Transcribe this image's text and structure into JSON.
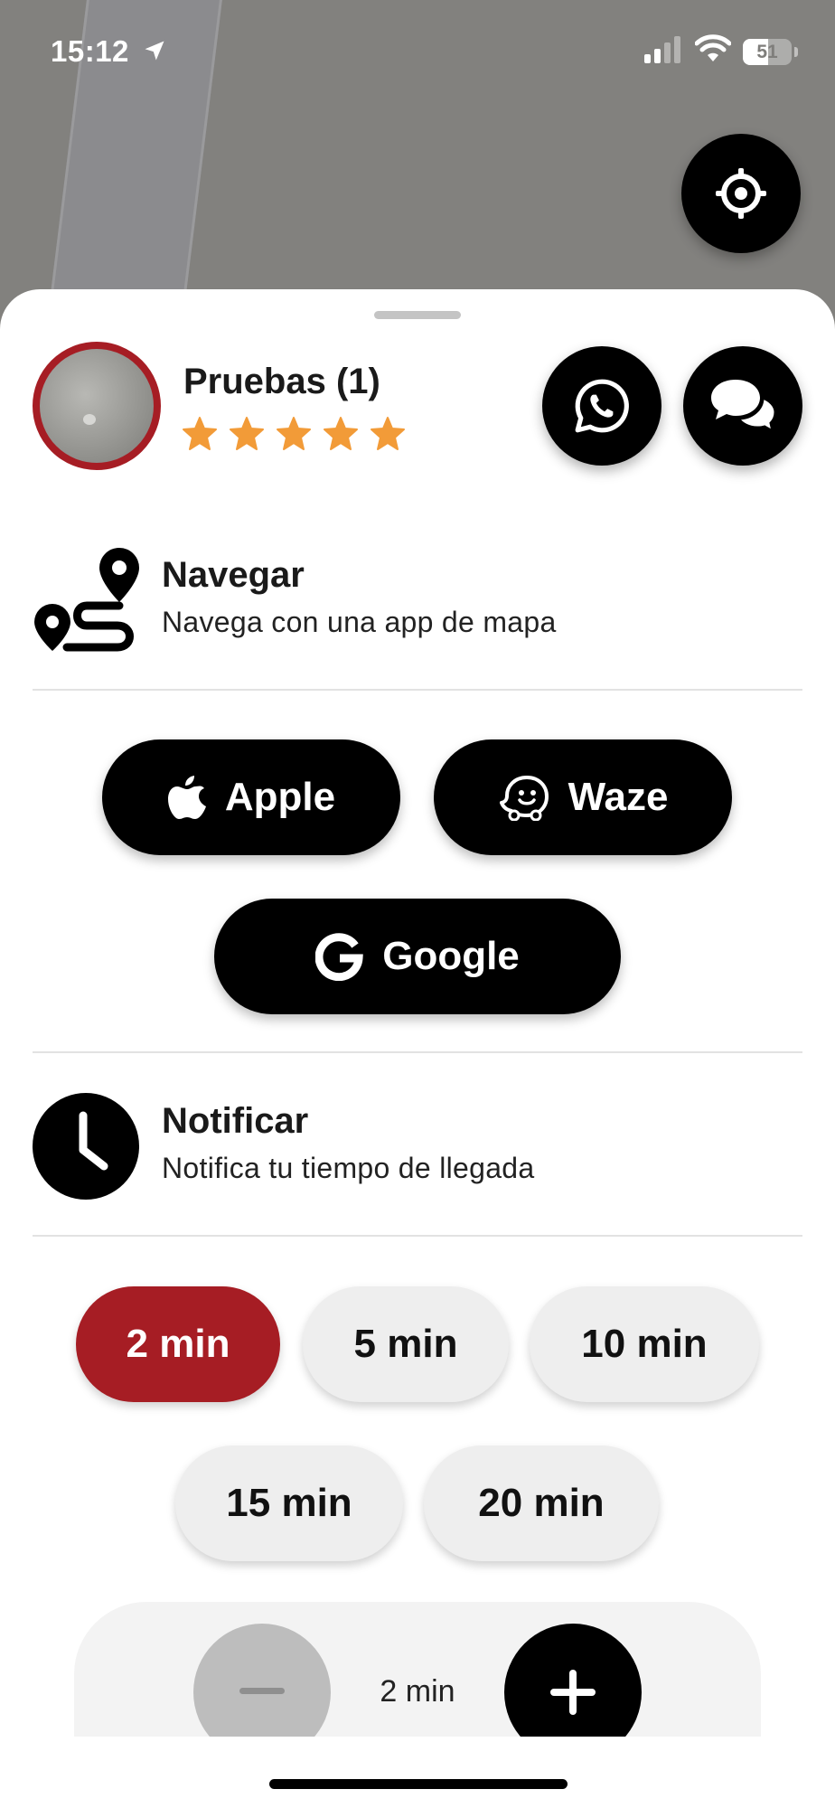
{
  "status_bar": {
    "time": "15:12",
    "battery": "51",
    "battery_level": 0.51,
    "icons": [
      "location-arrow-icon",
      "cellular-signal-icon",
      "wifi-icon",
      "battery-icon"
    ]
  },
  "map": {
    "locate_button_icon": "crosshair-icon"
  },
  "driver": {
    "name": "Pruebas (1)",
    "rating": 5,
    "rating_max": 5,
    "avatar_border_color": "#a61d24",
    "star_color": "#f29b38",
    "actions": [
      {
        "icon": "whatsapp-icon"
      },
      {
        "icon": "chat-bubbles-icon"
      }
    ]
  },
  "navigate": {
    "title": "Navegar",
    "subtitle": "Navega con una app de mapa",
    "icon": "route-icon",
    "apps": [
      {
        "label": "Apple",
        "icon": "apple-icon"
      },
      {
        "label": "Waze",
        "icon": "waze-icon"
      },
      {
        "label": "Google",
        "icon": "google-icon"
      }
    ]
  },
  "notify": {
    "title": "Notificar",
    "subtitle": "Notifica tu tiempo de llegada",
    "icon": "clock-icon",
    "accent_color": "#a61d24",
    "options": [
      "2 min",
      "5 min",
      "10 min",
      "15 min",
      "20 min"
    ],
    "selected": "2 min",
    "stepper_value": "2 min"
  }
}
